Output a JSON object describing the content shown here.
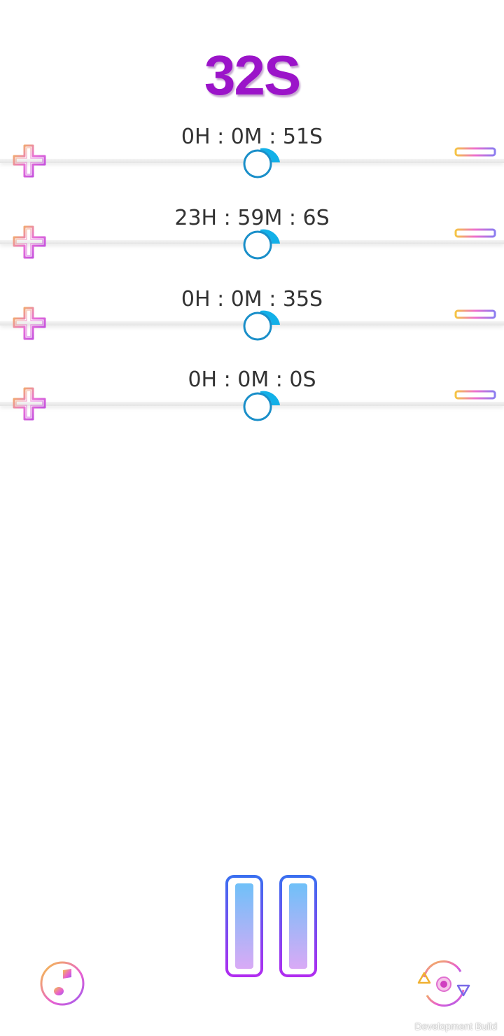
{
  "main_timer": "32S",
  "timers": [
    {
      "time": "0H : 0M : 51S"
    },
    {
      "time": "23H : 59M : 6S"
    },
    {
      "time": "0H : 0M : 35S"
    },
    {
      "time": "0H : 0M : 0S"
    }
  ],
  "icons": {
    "plus": "plus-icon",
    "minus": "minus-icon",
    "knob": "slider-knob-icon",
    "pause": "pause-icon",
    "music": "music-note-icon",
    "reset": "reset-icon"
  },
  "colors": {
    "main_timer": "#9b14c9",
    "knob_ring": "#1a8fc9",
    "knob_accent": "#12b0e8",
    "pause_outer_top": "#3a6ff0",
    "pause_outer_bottom": "#b02cf0"
  },
  "footer": {
    "dev_build": "Development Build"
  }
}
